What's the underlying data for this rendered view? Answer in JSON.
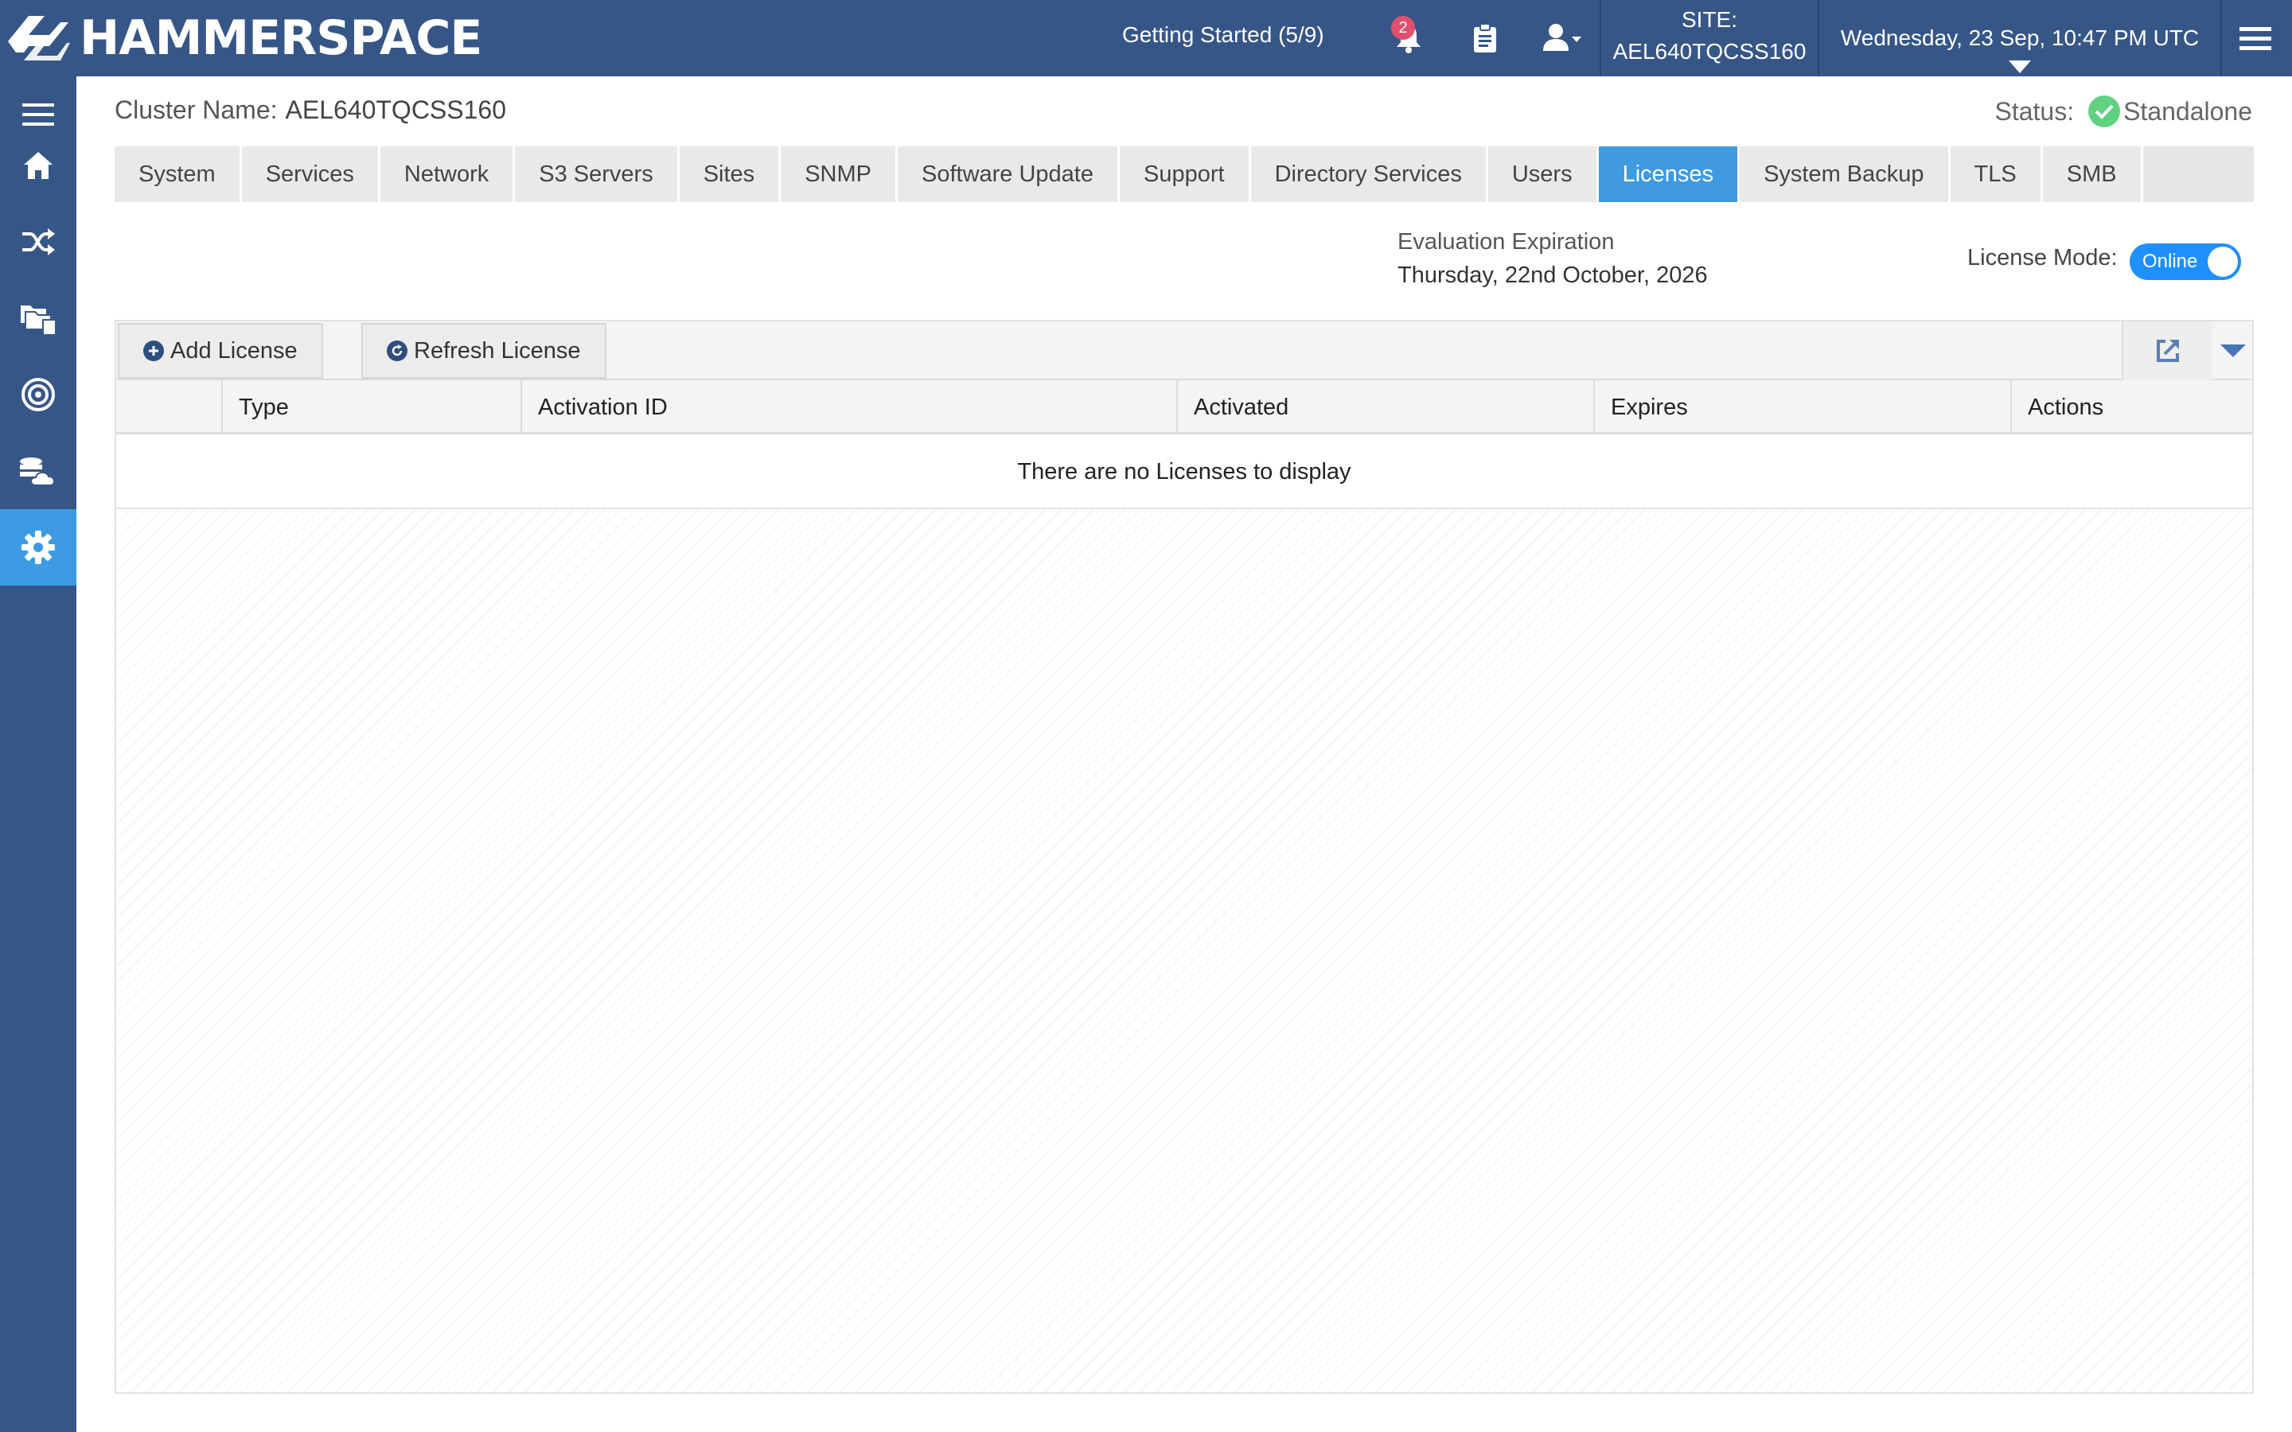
{
  "brand": {
    "name": "HAMMERSPACE"
  },
  "header": {
    "getting_started": "Getting Started (5/9)",
    "notification_count": "2",
    "site_label": "SITE:",
    "site_name": "AEL640TQCSS160",
    "datetime": "Wednesday, 23 Sep, 10:47 PM UTC",
    "icons": [
      "bell-icon",
      "clipboard-icon",
      "user-icon",
      "hamburger-menu-icon"
    ]
  },
  "sidebar": {
    "items": [
      {
        "icon": "menu-icon"
      },
      {
        "icon": "home-icon"
      },
      {
        "icon": "shuffle-icon"
      },
      {
        "icon": "files-icon"
      },
      {
        "icon": "target-icon"
      },
      {
        "icon": "storage-cloud-icon"
      },
      {
        "icon": "gear-icon",
        "active": true
      }
    ]
  },
  "cluster": {
    "label": "Cluster Name:",
    "name": "AEL640TQCSS160",
    "status_label": "Status:",
    "status_value": "Standalone"
  },
  "tabs": [
    {
      "label": "System"
    },
    {
      "label": "Services"
    },
    {
      "label": "Network"
    },
    {
      "label": "S3 Servers"
    },
    {
      "label": "Sites"
    },
    {
      "label": "SNMP"
    },
    {
      "label": "Software Update"
    },
    {
      "label": "Support"
    },
    {
      "label": "Directory Services"
    },
    {
      "label": "Users"
    },
    {
      "label": "Licenses",
      "active": true
    },
    {
      "label": "System Backup"
    },
    {
      "label": "TLS"
    },
    {
      "label": "SMB"
    }
  ],
  "license": {
    "eval_title": "Evaluation Expiration",
    "eval_date": "Thursday, 22nd October, 2026",
    "mode_label": "License Mode:",
    "mode_value": "Online"
  },
  "toolbar": {
    "add_label": "Add License",
    "refresh_label": "Refresh License"
  },
  "table": {
    "columns": [
      "",
      "Type",
      "Activation ID",
      "Activated",
      "Expires",
      "Actions"
    ],
    "empty_message": "There are no Licenses to display"
  },
  "colors": {
    "header_bg": "#365687",
    "accent": "#3f9ae0",
    "toggle": "#1e90ff",
    "status_ok": "#5fd17f",
    "badge": "#e0506e"
  }
}
